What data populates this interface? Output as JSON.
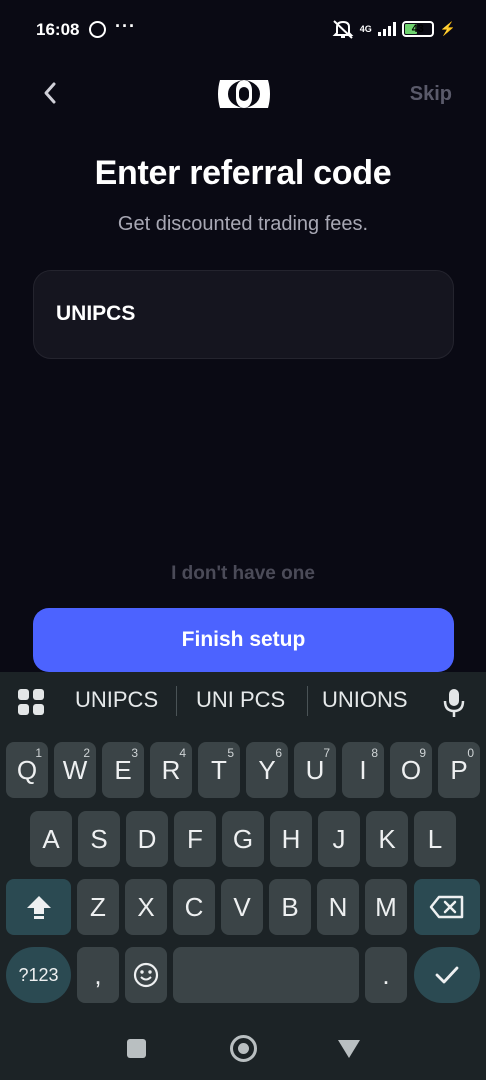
{
  "status_bar": {
    "time": "16:08",
    "dots": "···",
    "network": "4G",
    "battery": "43",
    "battery_level_percent": 43,
    "battery_color": "#6fd36f"
  },
  "header": {
    "back_icon": "chevron-left-icon",
    "logo_icon": "app-logo-icon",
    "skip_label": "Skip"
  },
  "main": {
    "title": "Enter referral code",
    "subtitle": "Get discounted trading fees.",
    "referral_input_value": "UNIPCS",
    "no_code_label": "I don't have one",
    "finish_button_label": "Finish setup",
    "accent_color": "#4c63ff"
  },
  "keyboard": {
    "suggestions": [
      "UNIPCS",
      "UNI PCS",
      "UNIONS"
    ],
    "row1": [
      {
        "key": "Q",
        "num": "1"
      },
      {
        "key": "W",
        "num": "2"
      },
      {
        "key": "E",
        "num": "3"
      },
      {
        "key": "R",
        "num": "4"
      },
      {
        "key": "T",
        "num": "5"
      },
      {
        "key": "Y",
        "num": "6"
      },
      {
        "key": "U",
        "num": "7"
      },
      {
        "key": "I",
        "num": "8"
      },
      {
        "key": "O",
        "num": "9"
      },
      {
        "key": "P",
        "num": "0"
      }
    ],
    "row2": [
      "A",
      "S",
      "D",
      "F",
      "G",
      "H",
      "J",
      "K",
      "L"
    ],
    "row3": [
      "Z",
      "X",
      "C",
      "V",
      "B",
      "N",
      "M"
    ],
    "symbols_label": "?123",
    "comma_label": ",",
    "period_label": "."
  },
  "nav_bar": {
    "recents_icon": "square-icon",
    "home_icon": "circle-home-icon",
    "back_icon": "triangle-back-icon"
  }
}
